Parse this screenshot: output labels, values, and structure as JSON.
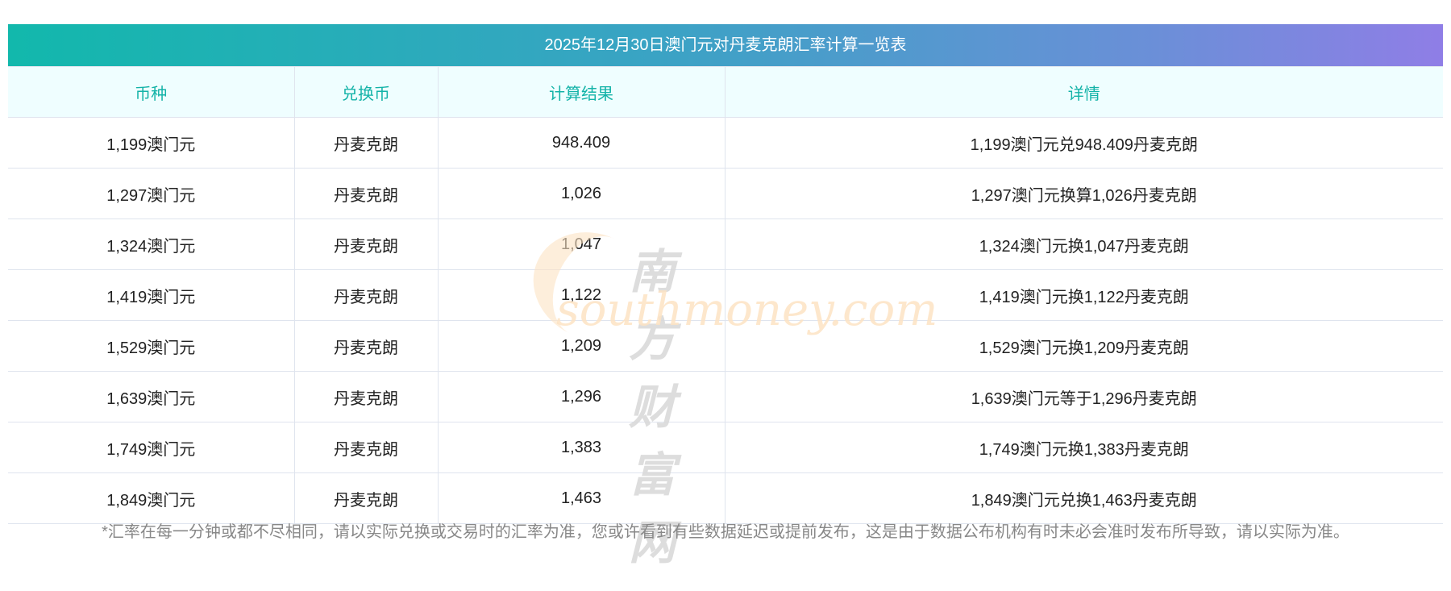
{
  "title": "2025年12月30日澳门元对丹麦克朗汇率计算一览表",
  "headers": [
    "币种",
    "兑换币",
    "计算结果",
    "详情"
  ],
  "rows": [
    [
      "1,199澳门元",
      "丹麦克朗",
      "948.409",
      "1,199澳门元兑948.409丹麦克朗"
    ],
    [
      "1,297澳门元",
      "丹麦克朗",
      "1,026",
      "1,297澳门元换算1,026丹麦克朗"
    ],
    [
      "1,324澳门元",
      "丹麦克朗",
      "1,047",
      "1,324澳门元换1,047丹麦克朗"
    ],
    [
      "1,419澳门元",
      "丹麦克朗",
      "1,122",
      "1,419澳门元换1,122丹麦克朗"
    ],
    [
      "1,529澳门元",
      "丹麦克朗",
      "1,209",
      "1,529澳门元换1,209丹麦克朗"
    ],
    [
      "1,639澳门元",
      "丹麦克朗",
      "1,296",
      "1,639澳门元等于1,296丹麦克朗"
    ],
    [
      "1,749澳门元",
      "丹麦克朗",
      "1,383",
      "1,749澳门元换1,383丹麦克朗"
    ],
    [
      "1,849澳门元",
      "丹麦克朗",
      "1,463",
      "1,849澳门元兑换1,463丹麦克朗"
    ]
  ],
  "note": "*汇率在每一分钟或都不尽相同，请以实际兑换或交易时的汇率为准，您或许看到有些数据延迟或提前发布，这是由于数据公布机构有时未必会准时发布所导致，请以实际为准。",
  "watermark": {
    "cn": "南方财富网",
    "en": "southmoney.com"
  }
}
